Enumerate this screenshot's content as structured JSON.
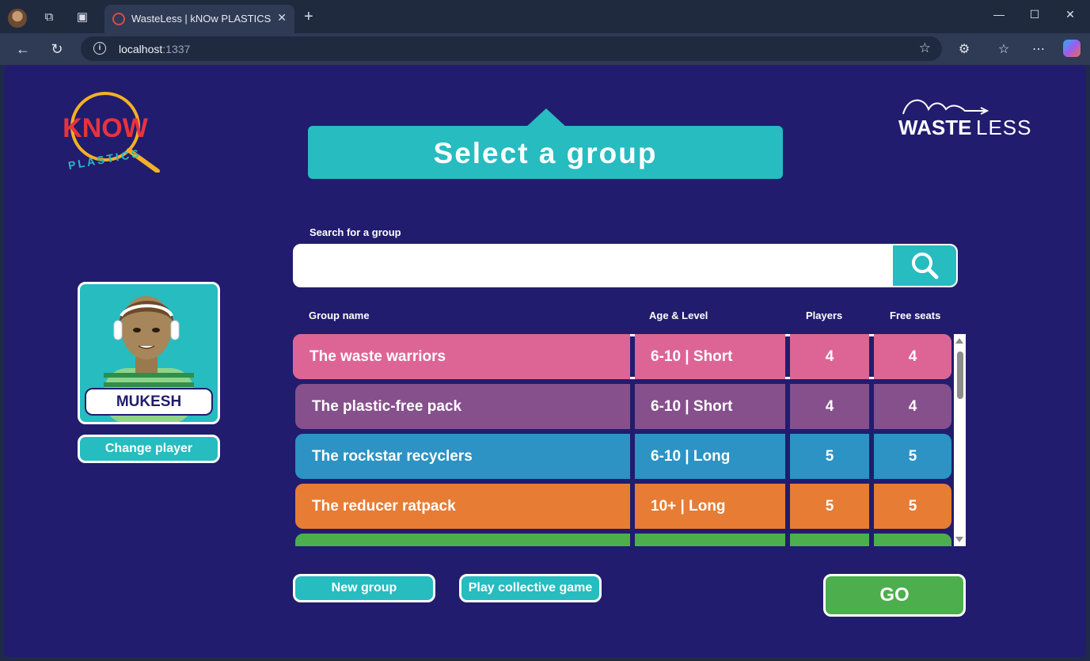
{
  "browser": {
    "tab_title": "WasteLess | kNOw PLASTICS",
    "url_host": "localhost",
    "url_port": ":1337"
  },
  "page": {
    "title": "Select a group",
    "know_logo": {
      "word": "KNOW",
      "sub": "PLASTICS"
    },
    "wasteless_logo": {
      "bold": "WASTE",
      "light": "LESS"
    },
    "search": {
      "label": "Search for a group",
      "value": "",
      "placeholder": ""
    },
    "columns": {
      "name": "Group name",
      "age": "Age & Level",
      "players": "Players",
      "seats": "Free seats"
    },
    "groups": [
      {
        "name": "The waste warriors",
        "age": "6-10 | Short",
        "players": "4",
        "seats": "4",
        "color": "#dd6596",
        "selected": true
      },
      {
        "name": "The plastic-free pack",
        "age": "6-10 | Short",
        "players": "4",
        "seats": "4",
        "color": "#86508c",
        "selected": false
      },
      {
        "name": "The rockstar recyclers",
        "age": "6-10 | Long",
        "players": "5",
        "seats": "5",
        "color": "#2c93c4",
        "selected": false
      },
      {
        "name": "The reducer ratpack",
        "age": "10+ | Long",
        "players": "5",
        "seats": "5",
        "color": "#e77c35",
        "selected": false
      },
      {
        "name": "",
        "age": "",
        "players": "",
        "seats": "",
        "color": "#4cae4c",
        "selected": false
      }
    ],
    "player": {
      "name": "MUKESH"
    },
    "buttons": {
      "change_player": "Change player",
      "new_group": "New group",
      "collective": "Play collective game",
      "go": "GO"
    }
  }
}
